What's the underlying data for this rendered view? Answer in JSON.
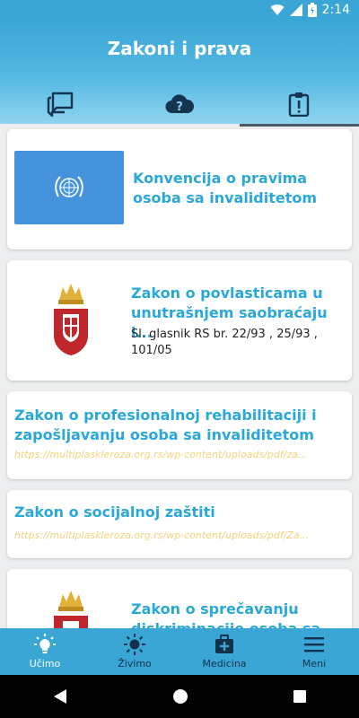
{
  "status_bar": {
    "time": "2:14"
  },
  "header": {
    "title": "Zakoni i prava"
  },
  "tabs": [
    {
      "icon": "chat-icon"
    },
    {
      "icon": "question-cloud-icon"
    },
    {
      "icon": "clipboard-alert-icon",
      "active": true
    }
  ],
  "cards": [
    {
      "title": "Konvencija o pravima osoba sa invaliditetom",
      "image": "un-flag"
    },
    {
      "title": "Zakon o povlasticama u unutrašnjem saobraćaju i...",
      "subtitle": "Sl. glasnik RS br. 22/93 , 25/93 , 101/05",
      "image": "serbia-coat-of-arms"
    },
    {
      "title": "Zakon o profesionalnoj rehabilitaciji i zapošljavanju osoba sa invaliditetom",
      "url": "https://multiplaskleroza.org.rs/wp-content/uploads/pdf/za..."
    },
    {
      "title": "Zakon o socijalnoj zaštiti",
      "url": "https://multiplaskleroza.org.rs/wp-content/uploads/pdf/Za..."
    },
    {
      "title": "Zakon o sprečavanju diskriminacije osoba sa...",
      "image": "serbia-coat-of-arms"
    }
  ],
  "bottom_nav": [
    {
      "label": "Učimo",
      "icon": "lightbulb-icon",
      "active": true
    },
    {
      "label": "Živimo",
      "icon": "sun-icon"
    },
    {
      "label": "Medicina",
      "icon": "medical-bag-icon"
    },
    {
      "label": "Meni",
      "icon": "menu-icon"
    }
  ],
  "colors": {
    "primary": "#3aa6d6",
    "title_text": "#2aa8d9",
    "url_text": "#f3d27a",
    "un_blue": "#4593dc"
  }
}
